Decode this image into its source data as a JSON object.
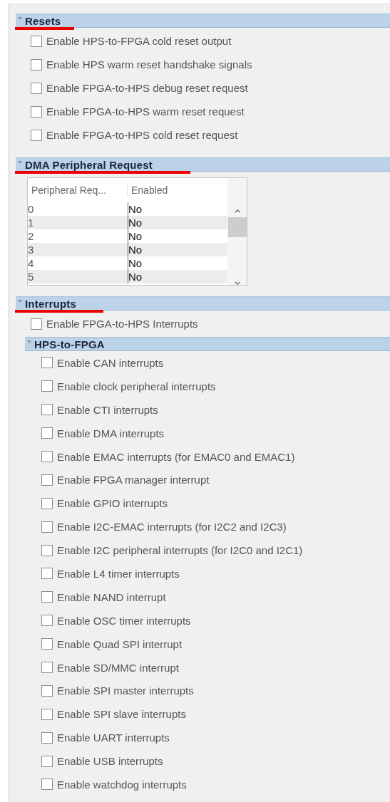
{
  "sections": [
    {
      "title": "Resets",
      "expanded": true,
      "underlined": true,
      "items": [
        {
          "kind": "checkbox",
          "label": "Enable HPS-to-FPGA cold reset output",
          "checked": false
        },
        {
          "kind": "checkbox",
          "label": "Enable HPS warm reset handshake signals",
          "checked": false
        },
        {
          "kind": "checkbox",
          "label": "Enable FPGA-to-HPS debug reset request",
          "checked": false
        },
        {
          "kind": "checkbox",
          "label": "Enable FPGA-to-HPS warm reset request",
          "checked": false
        },
        {
          "kind": "checkbox",
          "label": "Enable FPGA-to-HPS cold reset request",
          "checked": false
        }
      ]
    },
    {
      "title": "DMA Peripheral Request",
      "expanded": true,
      "underlined": true,
      "items": [
        {
          "kind": "table",
          "columns": [
            "Peripheral Req...",
            "Enabled"
          ],
          "rows": [
            [
              "0",
              "No"
            ],
            [
              "1",
              "No"
            ],
            [
              "2",
              "No"
            ],
            [
              "3",
              "No"
            ],
            [
              "4",
              "No"
            ],
            [
              "5",
              "No"
            ]
          ]
        }
      ]
    },
    {
      "title": "Interrupts",
      "expanded": true,
      "underlined": true,
      "items": [
        {
          "kind": "checkbox",
          "label": "Enable FPGA-to-HPS Interrupts",
          "checked": false
        },
        {
          "kind": "group",
          "title": "HPS-to-FPGA",
          "expanded": true,
          "items": [
            {
              "label": "Enable CAN interrupts",
              "checked": false
            },
            {
              "label": "Enable clock peripheral interrupts",
              "checked": false
            },
            {
              "label": "Enable CTI interrupts",
              "checked": false
            },
            {
              "label": "Enable DMA interrupts",
              "checked": false
            },
            {
              "label": "Enable EMAC interrupts (for EMAC0 and EMAC1)",
              "checked": false
            },
            {
              "label": "Enable FPGA manager interrupt",
              "checked": false
            },
            {
              "label": "Enable GPIO interrupts",
              "checked": false
            },
            {
              "label": "Enable I2C-EMAC interrupts (for I2C2 and I2C3)",
              "checked": false
            },
            {
              "label": "Enable I2C peripheral interrupts (for I2C0 and I2C1)",
              "checked": false
            },
            {
              "label": "Enable L4 timer interrupts",
              "checked": false
            },
            {
              "label": "Enable NAND interrupt",
              "checked": false
            },
            {
              "label": "Enable OSC timer interrupts",
              "checked": false
            },
            {
              "label": "Enable Quad SPI interrupt",
              "checked": false
            },
            {
              "label": "Enable SD/MMC interrupt",
              "checked": false
            },
            {
              "label": "Enable SPI master interrupts",
              "checked": false
            },
            {
              "label": "Enable SPI slave interrupts",
              "checked": false
            },
            {
              "label": "Enable UART interrupts",
              "checked": false
            },
            {
              "label": "Enable USB interrupts",
              "checked": false
            },
            {
              "label": "Enable watchdog interrupts",
              "checked": false
            }
          ]
        }
      ]
    }
  ]
}
